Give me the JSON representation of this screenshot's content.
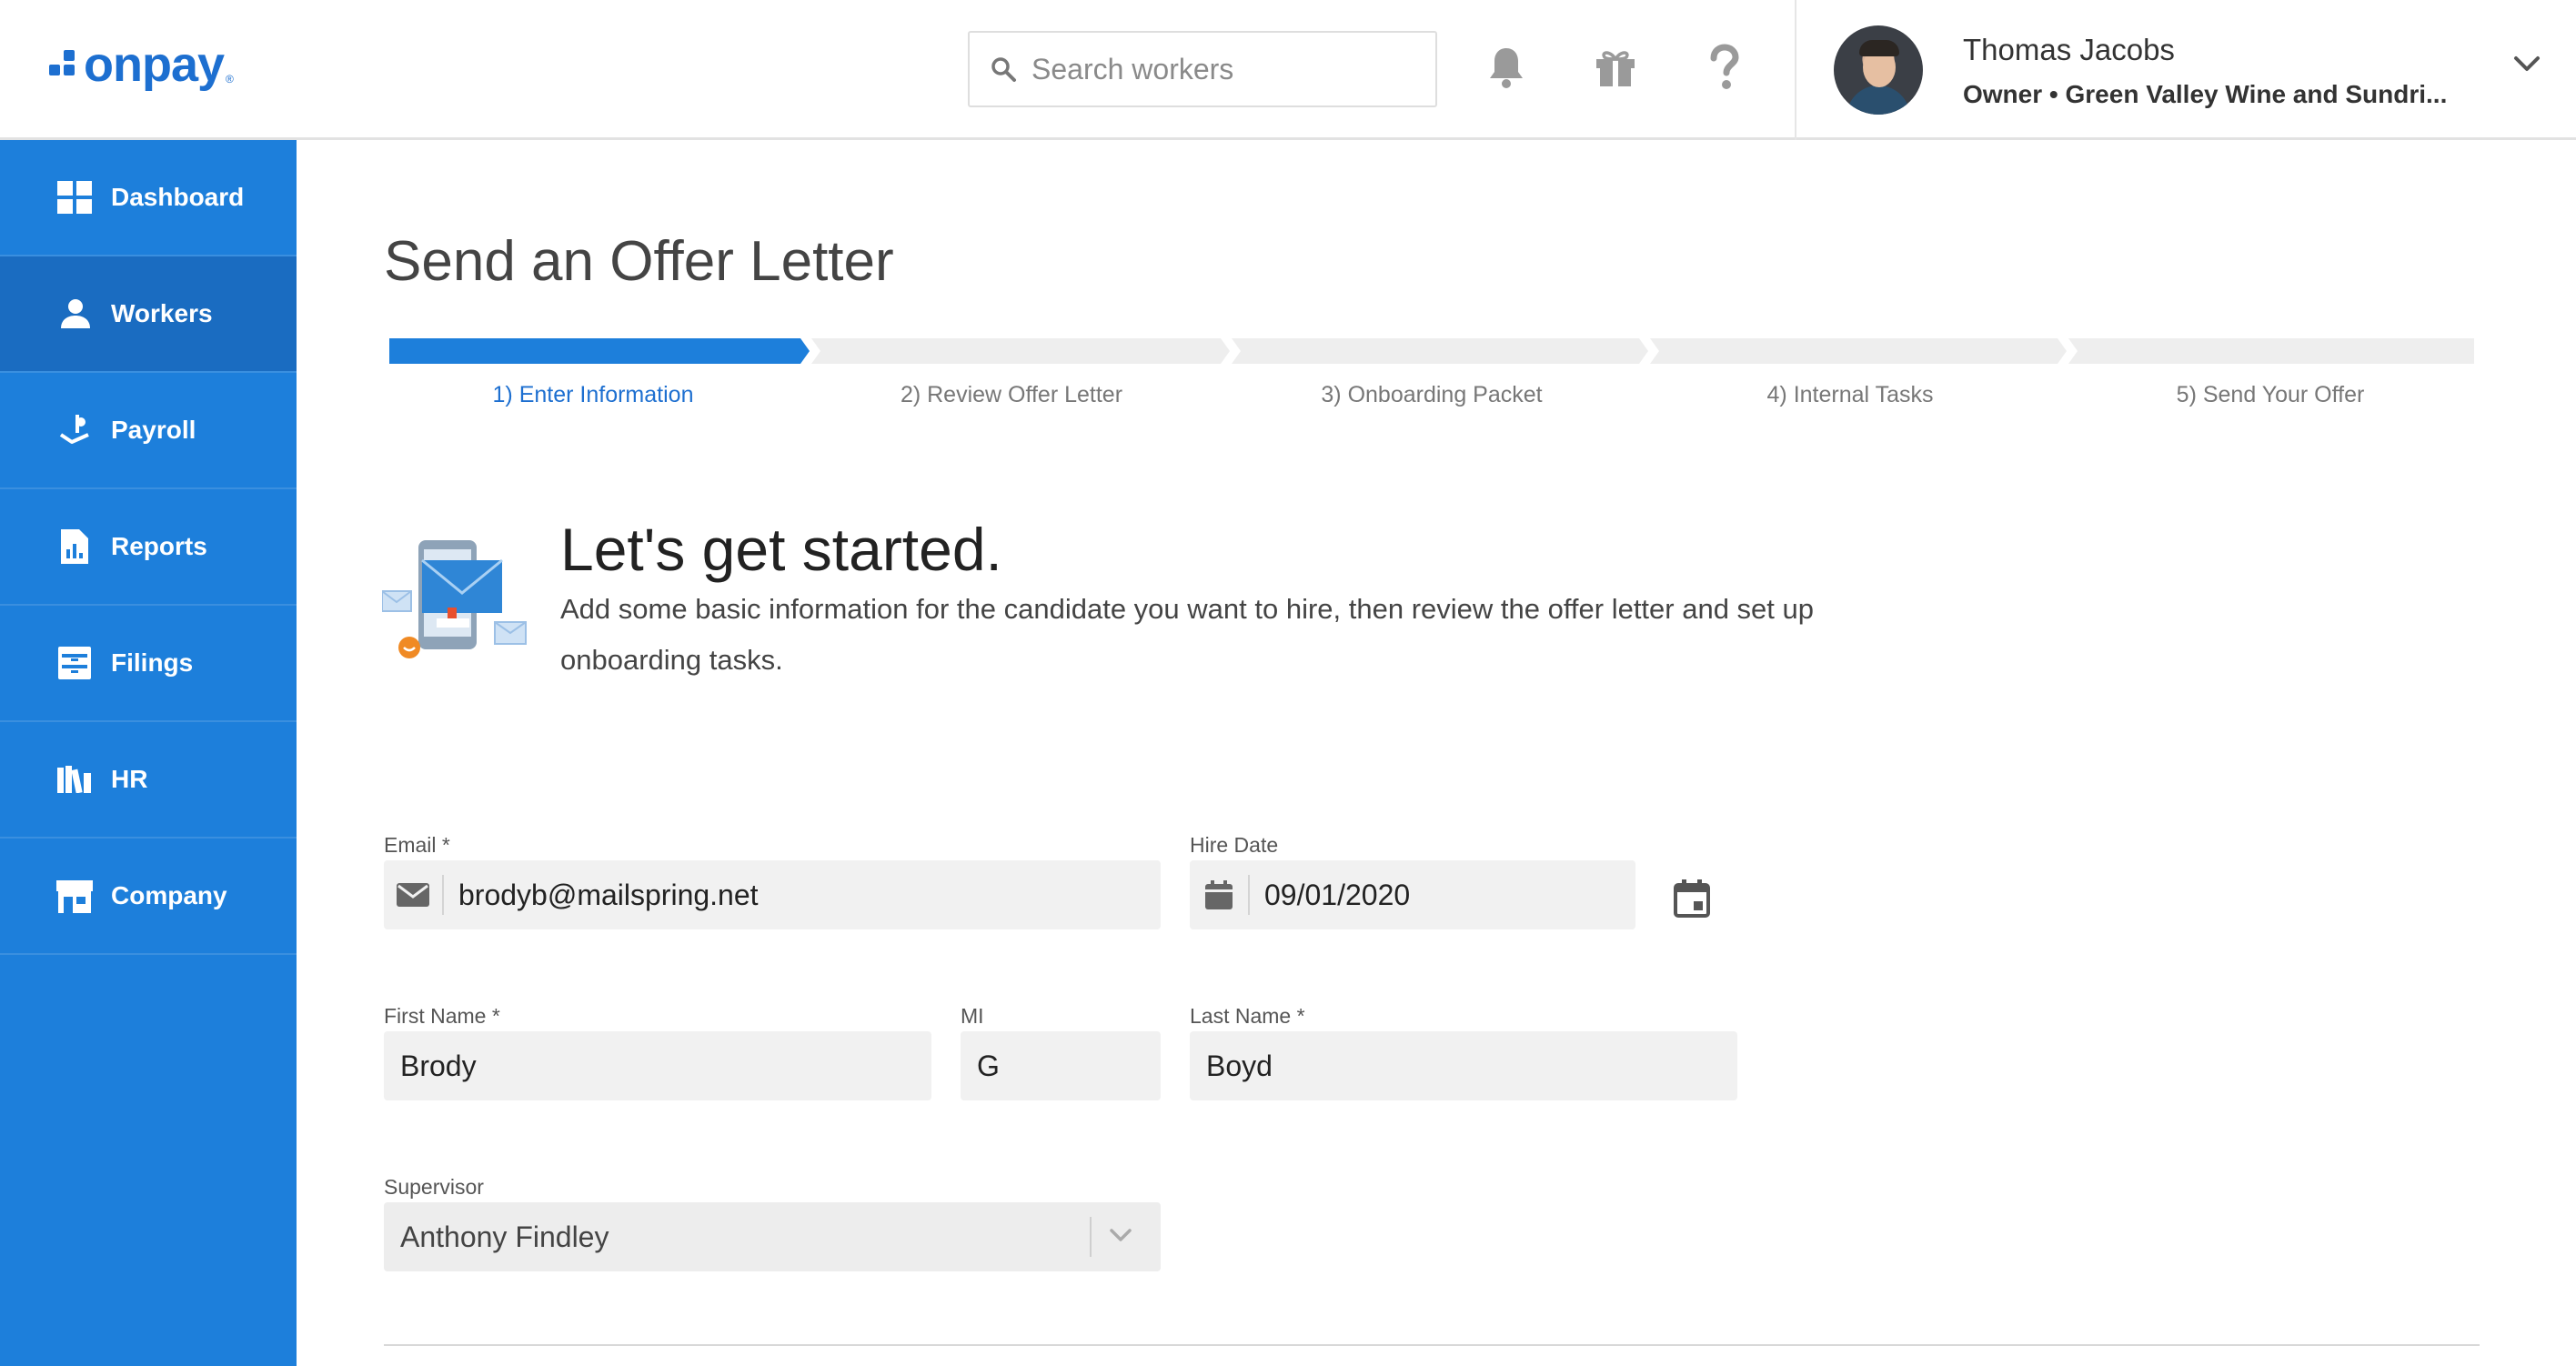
{
  "header": {
    "logo_text": "onpay",
    "logo_mark": "®",
    "search_placeholder": "Search workers",
    "icons": [
      "bell-icon",
      "gift-icon",
      "help-icon"
    ],
    "user": {
      "name": "Thomas Jacobs",
      "role": "Owner • Green Valley Wine and Sundri..."
    }
  },
  "sidebar": {
    "items": [
      {
        "label": "Dashboard",
        "icon": "dashboard-icon"
      },
      {
        "label": "Workers",
        "icon": "workers-icon",
        "active": true
      },
      {
        "label": "Payroll",
        "icon": "payroll-icon"
      },
      {
        "label": "Reports",
        "icon": "reports-icon"
      },
      {
        "label": "Filings",
        "icon": "filings-icon"
      },
      {
        "label": "HR",
        "icon": "hr-icon"
      },
      {
        "label": "Company",
        "icon": "company-icon"
      }
    ]
  },
  "main": {
    "title": "Send an Offer Letter",
    "steps": [
      {
        "label": "1) Enter Information",
        "active": true
      },
      {
        "label": "2) Review Offer Letter"
      },
      {
        "label": "3) Onboarding Packet"
      },
      {
        "label": "4) Internal Tasks"
      },
      {
        "label": "5) Send Your Offer"
      }
    ],
    "intro": {
      "title": "Let's get started.",
      "text": "Add some basic information for the candidate you want to hire, then review the offer letter and set up onboarding tasks."
    },
    "form": {
      "email": {
        "label": "Email",
        "required": "*",
        "value": "brodyb@mailspring.net"
      },
      "hire_date": {
        "label": "Hire Date",
        "value": "09/01/2020"
      },
      "first_name": {
        "label": "First Name",
        "required": "*",
        "value": "Brody"
      },
      "mi": {
        "label": "MI",
        "value": "G"
      },
      "last_name": {
        "label": "Last Name",
        "required": "*",
        "value": "Boyd"
      },
      "supervisor": {
        "label": "Supervisor",
        "value": "Anthony Findley"
      }
    }
  },
  "colors": {
    "brand": "#1d6fd0",
    "sidebar": "#1d7fdb",
    "sidebar_active": "#1a6cc1",
    "field_bg": "#f1f1f1"
  }
}
